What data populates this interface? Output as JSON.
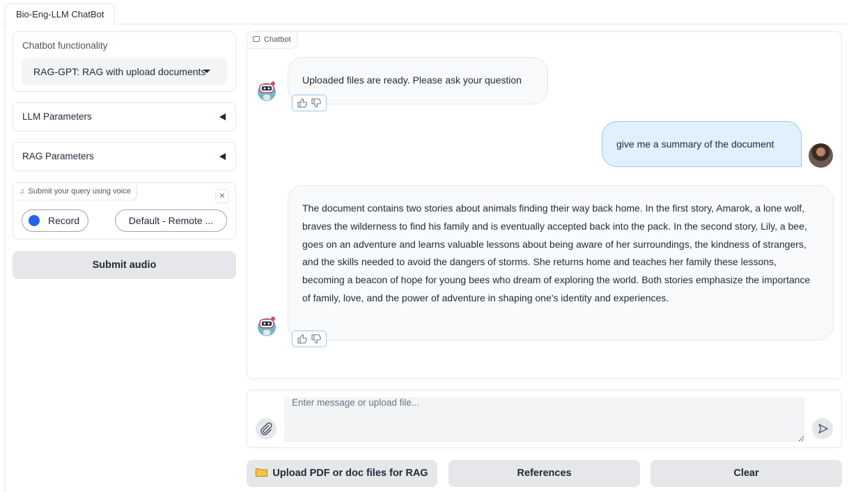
{
  "tabs": [
    {
      "label": "Bio-Eng-LLM ChatBot",
      "active": true
    }
  ],
  "sidebar": {
    "functionality_label": "Chatbot functionality",
    "functionality_value": "RAG-GPT: RAG with upload documents",
    "llm_params_label": "LLM Parameters",
    "rag_params_label": "RAG Parameters",
    "audio": {
      "label": "Submit your query using voice",
      "record_label": "Record",
      "device_value": "Default - Remote ..."
    },
    "submit_audio_label": "Submit audio"
  },
  "chat": {
    "label": "Chatbot",
    "messages": [
      {
        "role": "bot",
        "text": "Uploaded files are ready. Please ask your question"
      },
      {
        "role": "user",
        "text": "give me a summary of the document"
      },
      {
        "role": "bot",
        "text": "The document contains two stories about animals finding their way back home. In the first story, Amarok, a lone wolf, braves the wilderness to find his family and is eventually accepted back into the pack. In the second story, Lily, a bee, goes on an adventure and learns valuable lessons about being aware of her surroundings, the kindness of strangers, and the skills needed to avoid the dangers of storms. She returns home and teaches her family these lessons, becoming a beacon of hope for young bees who dream of exploring the world. Both stories emphasize the importance of family, love, and the power of adventure in shaping one's identity and experiences."
      }
    ]
  },
  "input": {
    "placeholder": "Enter message or upload file...",
    "value": ""
  },
  "buttons": {
    "upload_label": "Upload PDF or doc files for RAG",
    "references_label": "References",
    "clear_label": "Clear"
  },
  "icons": {
    "attach": "paperclip-icon",
    "send": "send-arrow-icon",
    "folder": "folder-icon",
    "bot_avatar": "robot-avatar",
    "like": "thumbs-up-icon",
    "dislike": "thumbs-down-icon"
  },
  "colors": {
    "record_dot": "#2563eb",
    "user_bubble": "#e0f0fd",
    "user_bubble_border": "#9dc7ec",
    "button_bg": "#e5e7eb"
  }
}
